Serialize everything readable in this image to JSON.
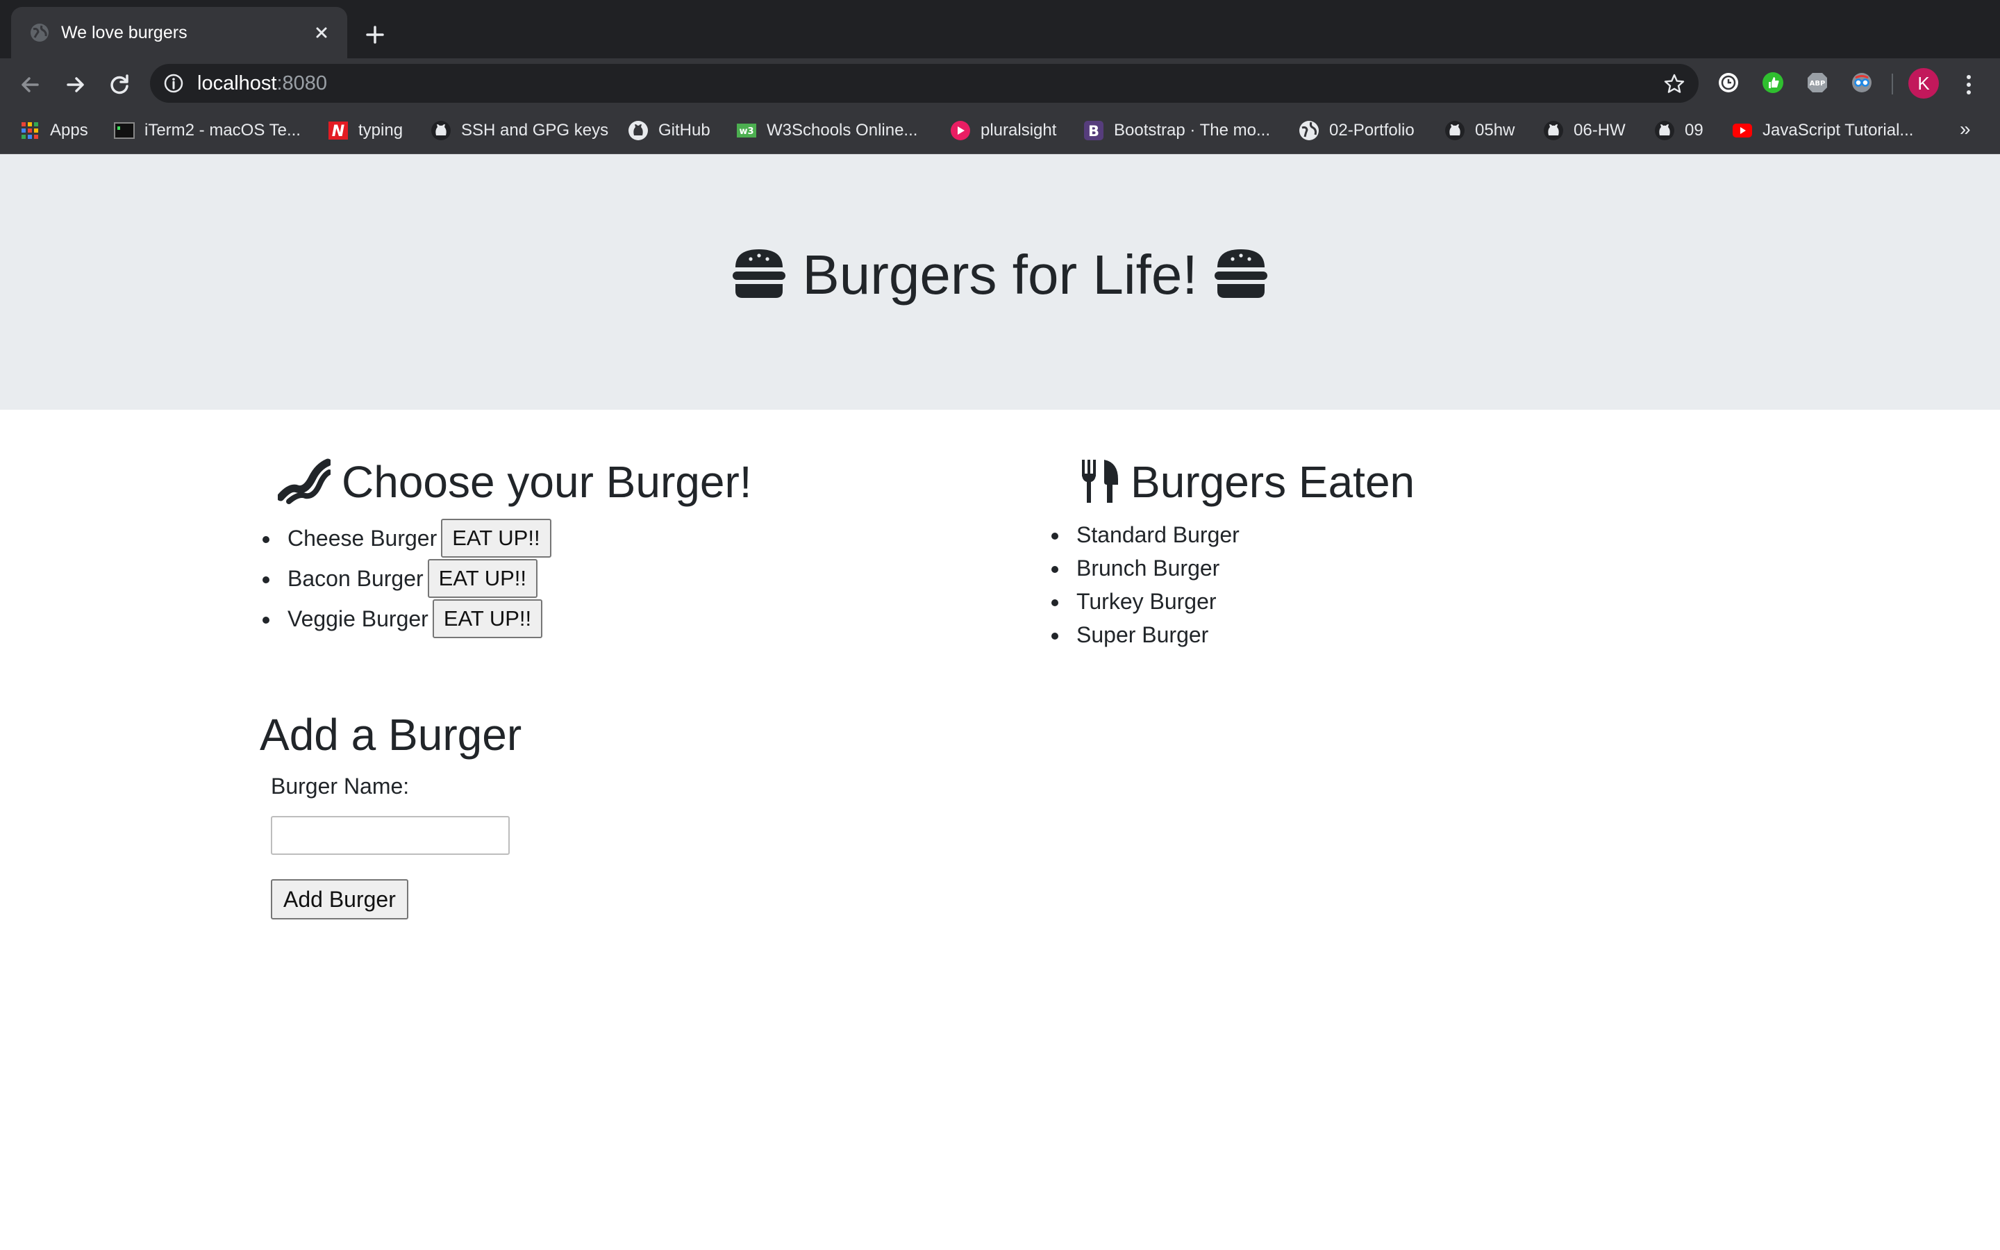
{
  "browser": {
    "tab": {
      "title": "We love burgers"
    },
    "url": {
      "host": "localhost",
      "port": ":8080"
    },
    "profile_initial": "K",
    "bookmarks": [
      {
        "label": "Apps",
        "icon": "apps-grid-icon"
      },
      {
        "label": "iTerm2 - macOS Te...",
        "icon": "terminal-icon"
      },
      {
        "label": "typing",
        "icon": "n-logo-icon"
      },
      {
        "label": "SSH and GPG keys",
        "icon": "github-icon"
      },
      {
        "label": "GitHub",
        "icon": "github-icon"
      },
      {
        "label": "W3Schools Online...",
        "icon": "w3schools-icon"
      },
      {
        "label": "pluralsight",
        "icon": "pluralsight-icon"
      },
      {
        "label": "Bootstrap · The mo...",
        "icon": "bootstrap-icon"
      },
      {
        "label": "02-Portfolio",
        "icon": "globe-icon"
      },
      {
        "label": "05hw",
        "icon": "github-icon"
      },
      {
        "label": "06-HW",
        "icon": "github-icon"
      },
      {
        "label": "09",
        "icon": "github-icon"
      },
      {
        "label": "JavaScript Tutorial...",
        "icon": "youtube-icon"
      }
    ],
    "more_bookmarks": "»"
  },
  "page": {
    "title": "Burgers for Life!",
    "choose": {
      "heading": "Choose your Burger!",
      "button_label": "EAT UP!!",
      "burgers": [
        "Cheese Burger",
        "Bacon Burger",
        "Veggie Burger"
      ]
    },
    "eaten": {
      "heading": "Burgers Eaten",
      "burgers": [
        "Standard Burger",
        "Brunch Burger",
        "Turkey Burger",
        "Super Burger"
      ]
    },
    "add": {
      "heading": "Add a Burger",
      "label": "Burger Name:",
      "input_value": "",
      "button_label": "Add Burger"
    }
  }
}
